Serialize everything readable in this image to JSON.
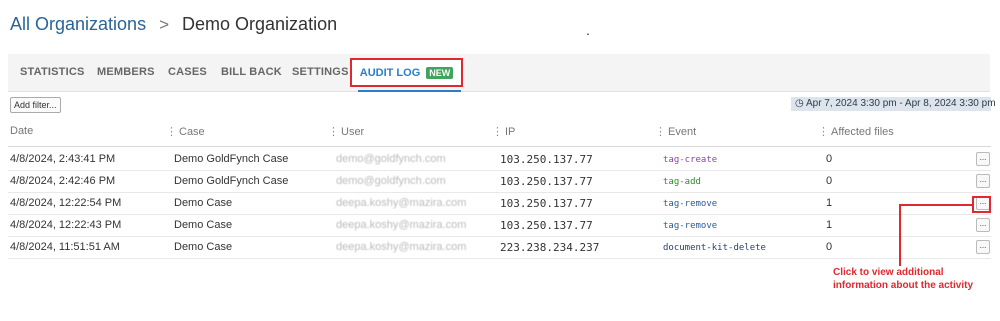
{
  "breadcrumb": {
    "parent": "All Organizations",
    "separator": ">",
    "current": "Demo Organization",
    "stray_mark": "."
  },
  "tabs": [
    {
      "label": "STATISTICS"
    },
    {
      "label": "MEMBERS"
    },
    {
      "label": "CASES"
    },
    {
      "label": "BILL BACK"
    },
    {
      "label": "SETTINGS"
    },
    {
      "label": "AUDIT LOG",
      "active": true,
      "badge": "NEW"
    }
  ],
  "toolbar": {
    "add_filter": "Add filter...",
    "date_range": "Apr 7, 2024 3:30 pm - Apr 8, 2024 3:30 pm",
    "date_range_icon": "clock-icon"
  },
  "table": {
    "columns": [
      "Date",
      "Case",
      "User",
      "IP",
      "Event",
      "Affected files"
    ],
    "rows": [
      {
        "date": "4/8/2024, 2:43:41 PM",
        "case": "Demo GoldFynch Case",
        "user": "demo@goldfynch.com",
        "ip": "103.250.137.77",
        "event": "tag-create",
        "files": "0",
        "more": "..."
      },
      {
        "date": "4/8/2024, 2:42:46 PM",
        "case": "Demo GoldFynch Case",
        "user": "demo@goldfynch.com",
        "ip": "103.250.137.77",
        "event": "tag-add",
        "files": "0",
        "more": "..."
      },
      {
        "date": "4/8/2024, 12:22:54 PM",
        "case": "Demo Case",
        "user": "deepa.koshy@mazira.com",
        "ip": "103.250.137.77",
        "event": "tag-remove",
        "files": "1",
        "more": "..."
      },
      {
        "date": "4/8/2024, 12:22:43 PM",
        "case": "Demo Case",
        "user": "deepa.koshy@mazira.com",
        "ip": "103.250.137.77",
        "event": "tag-remove",
        "files": "1",
        "more": "..."
      },
      {
        "date": "4/8/2024, 11:51:51 AM",
        "case": "Demo Case",
        "user": "deepa.koshy@mazira.com",
        "ip": "223.238.234.237",
        "event": "document-kit-delete",
        "files": "0",
        "more": "..."
      }
    ]
  },
  "annotation": {
    "line1": "Click to view additional",
    "line2": "information about the activity"
  },
  "colors": {
    "link": "#2a6496",
    "active_tab": "#2a7fc9",
    "badge_new": "#3ea55a",
    "annotation_red": "#e0282e",
    "event_tag_create": "#8e44ad",
    "event_tag_add": "#2e8b2e",
    "event_tag_remove": "#2a5b9a",
    "event_document_kit_delete": "#2c3e70"
  }
}
